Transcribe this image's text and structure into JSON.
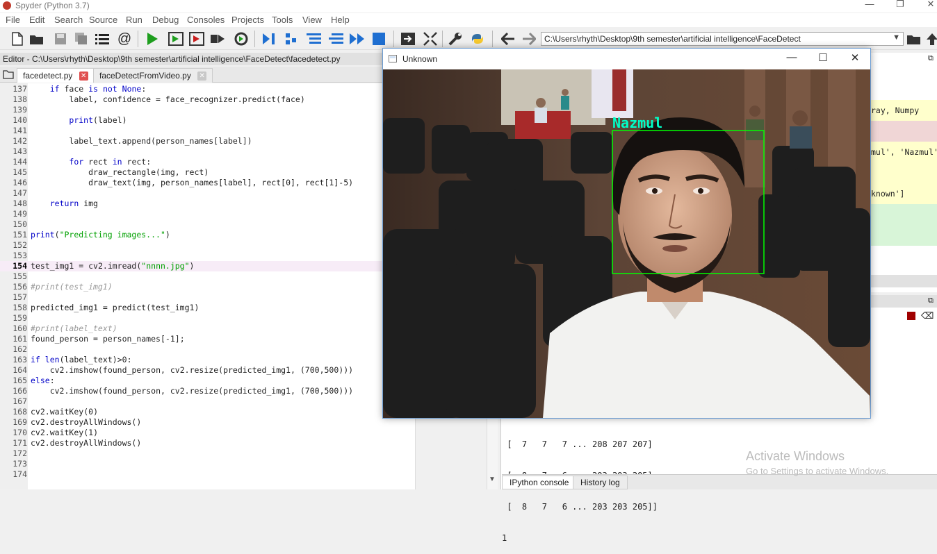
{
  "app": {
    "title": "Spyder (Python 3.7)",
    "window_controls": [
      "—",
      "❐",
      "✕"
    ]
  },
  "menu": [
    "File",
    "Edit",
    "Search",
    "Source",
    "Run",
    "Debug",
    "Consoles",
    "Projects",
    "Tools",
    "View",
    "Help"
  ],
  "toolbar": {
    "path": "C:\\Users\\rhyth\\Desktop\\9th semester\\artificial intelligence\\FaceDetect"
  },
  "editor": {
    "header": "Editor - C:\\Users\\rhyth\\Desktop\\9th semester\\artificial intelligence\\FaceDetect\\facedetect.py",
    "tabs": [
      {
        "label": "facedetect.py",
        "active": true
      },
      {
        "label": "faceDetectFromVideo.py",
        "active": false
      }
    ],
    "current_line": 154,
    "lines": [
      {
        "n": "137",
        "code": "    if face is not None:"
      },
      {
        "n": "138",
        "code": "        label, confidence = face_recognizer.predict(face)"
      },
      {
        "n": "139",
        "code": ""
      },
      {
        "n": "140",
        "code": "        print(label)"
      },
      {
        "n": "141",
        "code": ""
      },
      {
        "n": "142",
        "code": "        label_text.append(person_names[label])"
      },
      {
        "n": "143",
        "code": ""
      },
      {
        "n": "144",
        "code": "        for rect in rect:"
      },
      {
        "n": "145",
        "code": "            draw_rectangle(img, rect)"
      },
      {
        "n": "146",
        "code": "            draw_text(img, person_names[label], rect[0], rect[1]-5)"
      },
      {
        "n": "147",
        "code": ""
      },
      {
        "n": "148",
        "code": "    return img"
      },
      {
        "n": "149",
        "code": ""
      },
      {
        "n": "150",
        "code": ""
      },
      {
        "n": "151",
        "code": "print(\"Predicting images...\")"
      },
      {
        "n": "152",
        "code": ""
      },
      {
        "n": "153",
        "code": ""
      },
      {
        "n": "154",
        "code": "test_img1 = cv2.imread(\"nnnn.jpg\")"
      },
      {
        "n": "155",
        "code": ""
      },
      {
        "n": "156",
        "code": "#print(test_img1)"
      },
      {
        "n": "157",
        "code": ""
      },
      {
        "n": "158",
        "code": "predicted_img1 = predict(test_img1)"
      },
      {
        "n": "159",
        "code": ""
      },
      {
        "n": "160",
        "code": "#print(label_text)"
      },
      {
        "n": "161",
        "code": "found_person = person_names[-1];"
      },
      {
        "n": "162",
        "code": ""
      },
      {
        "n": "163",
        "code": "if len(label_text)>0:"
      },
      {
        "n": "164",
        "code": "    cv2.imshow(found_person, cv2.resize(predicted_img1, (700,500)))"
      },
      {
        "n": "165",
        "code": "else:"
      },
      {
        "n": "166",
        "code": "    cv2.imshow(found_person, cv2.resize(predicted_img1, (700,500)))"
      },
      {
        "n": "167",
        "code": ""
      },
      {
        "n": "168",
        "code": "cv2.waitKey(0)"
      },
      {
        "n": "169",
        "code": "cv2.destroyAllWindows()"
      },
      {
        "n": "170",
        "code": "cv2.waitKey(1)"
      },
      {
        "n": "171",
        "code": "cv2.destroyAllWindows()"
      },
      {
        "n": "172",
        "code": ""
      },
      {
        "n": "173",
        "code": ""
      },
      {
        "n": "174",
        "code": ""
      }
    ]
  },
  "variable_explorer": {
    "rows": [
      {
        "text": "ray, Numpy",
        "color": "#ffffcc"
      },
      {
        "text": "",
        "color": "#f0d6d6"
      },
      {
        "text": "mul', 'Nazmul'",
        "color": "#ffffcc"
      },
      {
        "text": "",
        "color": "#ffffcc"
      },
      {
        "text": "known']",
        "color": "#ffffcc"
      },
      {
        "text": "",
        "color": "#d8f5d8"
      },
      {
        "text": "",
        "color": "#d8f5d8"
      }
    ]
  },
  "console": {
    "lines": [
      " [  7   7   7 ... 208 207 207]",
      " [  8   7   6 ... 203 203 205]",
      " [  8   7   6 ... 203 203 205]]",
      "1"
    ],
    "tabs": [
      {
        "label": "IPython console",
        "active": true
      },
      {
        "label": "History log",
        "active": false
      }
    ]
  },
  "watermark": {
    "line1": "Activate Windows",
    "line2": "Go to Settings to activate Windows."
  },
  "popup": {
    "title": "Unknown",
    "controls": [
      "—",
      "☐",
      "✕"
    ],
    "detected_label": "Nazmul",
    "label_color": "#00ffc8",
    "box_color": "#00ff00"
  },
  "colors": {
    "tab_close": "#e05050",
    "tab_close_inactive": "#c8c8c8",
    "keyword": "#0000c8",
    "string": "#00a000",
    "comment": "#999999"
  }
}
